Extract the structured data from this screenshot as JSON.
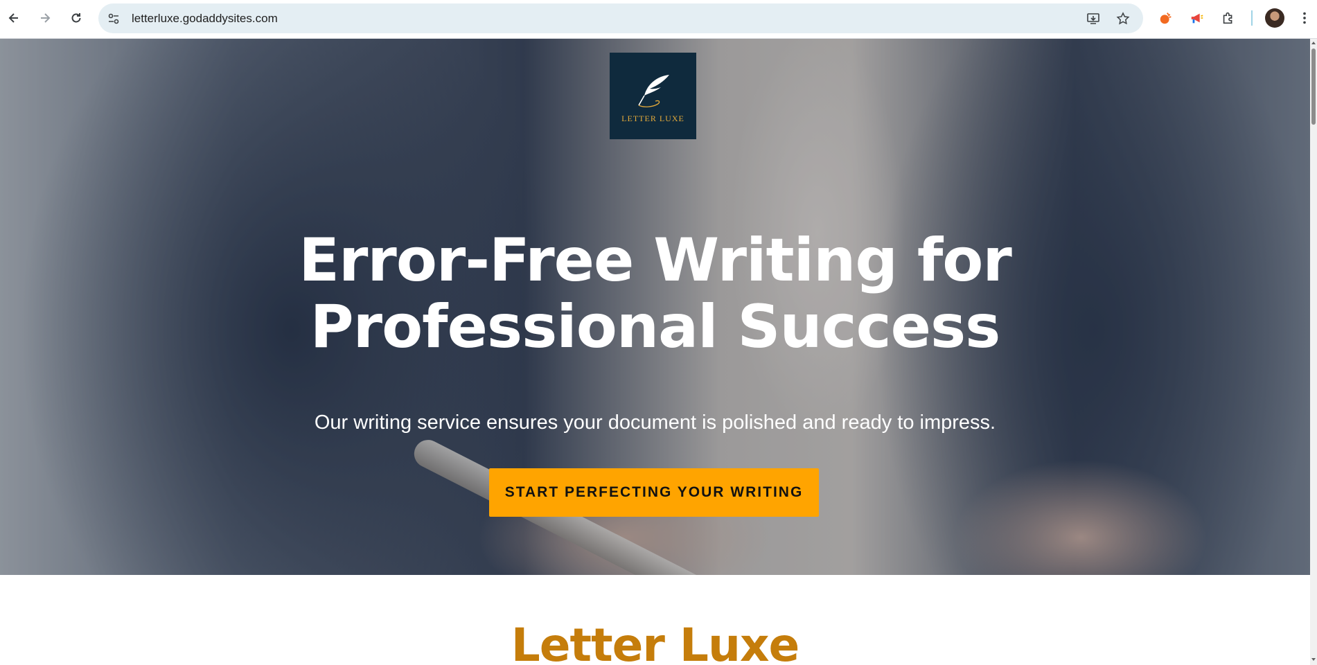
{
  "browser": {
    "url": "letterluxe.godaddysites.com",
    "icons": {
      "back": "arrow-left-icon",
      "forward": "arrow-right-icon",
      "reload": "reload-icon",
      "site_info": "tune-icon",
      "install": "install-app-icon",
      "bookmark": "star-icon",
      "extensions": "puzzle-icon",
      "menu": "kebab-menu-icon"
    }
  },
  "hero": {
    "logo_text": "LETTER LUXE",
    "headline_line1": "Error-Free Writing for",
    "headline_line2": "Professional Success",
    "subtitle": "Our writing service ensures your document is polished and ready to impress.",
    "cta_label": "START PERFECTING YOUR WRITING"
  },
  "section": {
    "title": "Letter Luxe"
  },
  "colors": {
    "accent_orange": "#ffa400",
    "title_gold": "#c57d0b",
    "logo_navy": "#0f2a3d",
    "logo_gold": "#e3a93a"
  }
}
